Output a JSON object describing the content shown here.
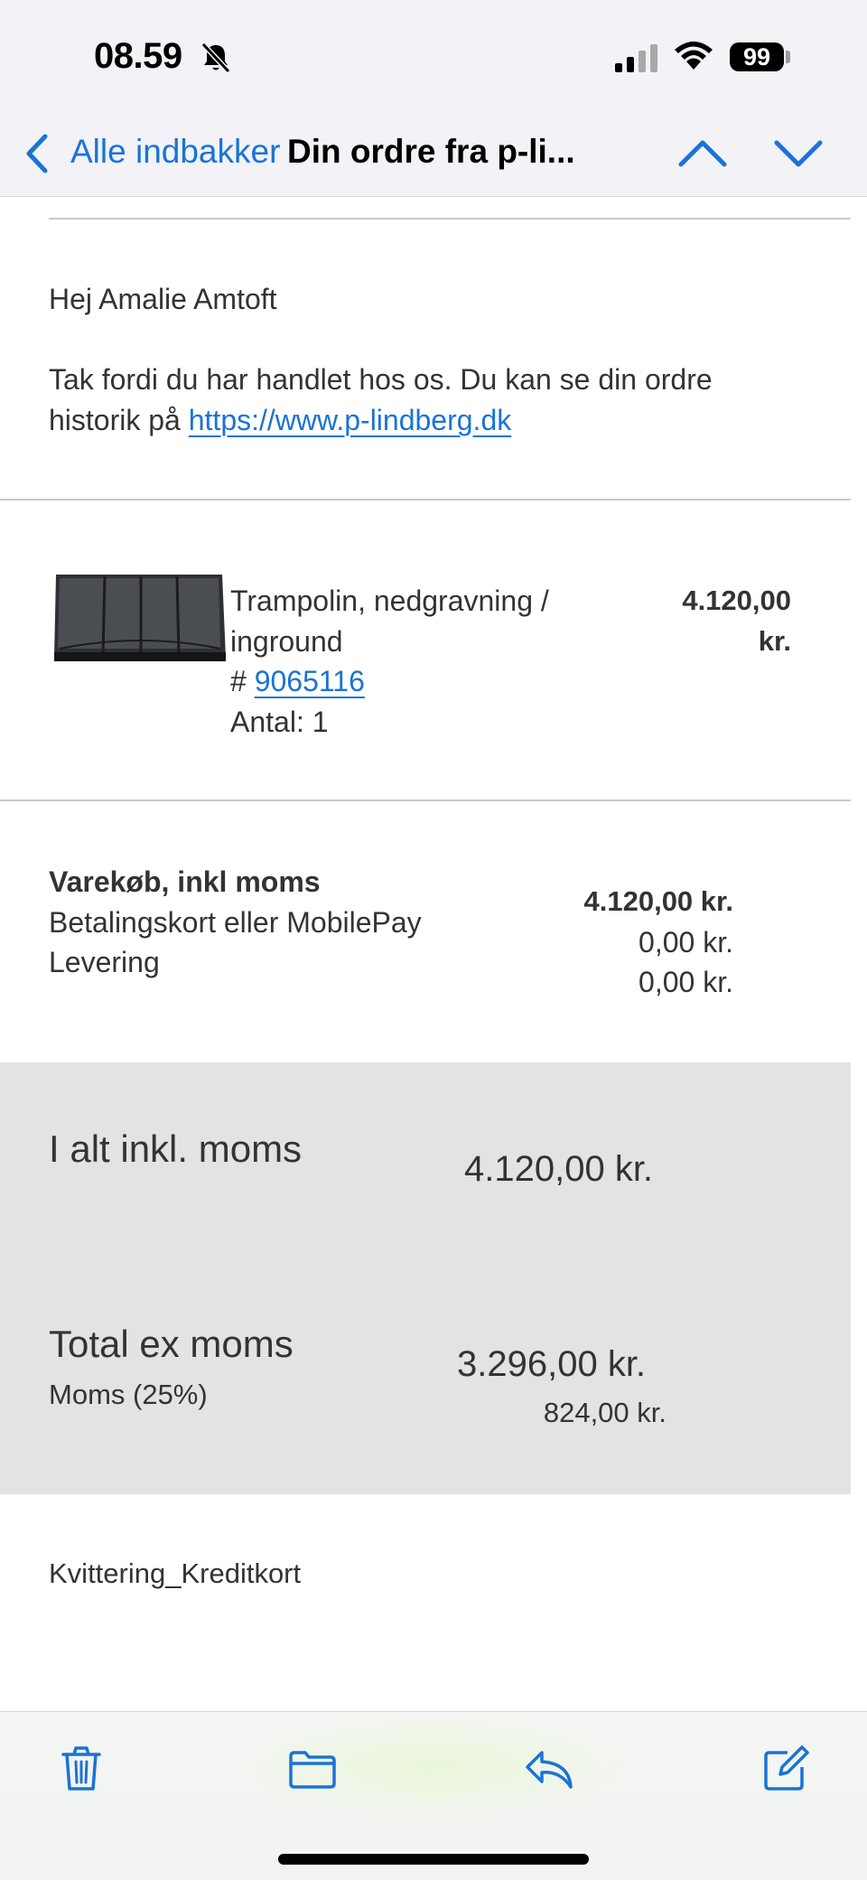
{
  "status_bar": {
    "time": "08.59",
    "battery": "99",
    "icons": [
      "bell-slash-icon",
      "cellular-signal-icon",
      "wifi-icon",
      "battery-icon"
    ]
  },
  "nav": {
    "back_label": "Alle indbakker",
    "title": "Din ordre fra p-li...",
    "accent_color": "#1a73d6"
  },
  "email": {
    "greeting": "Hej Amalie Amtoft",
    "intro_line1": "Tak fordi du har handlet hos os. Du kan se din ordre",
    "intro_line2_prefix": "historik på ",
    "history_link": "https://www.p-lindberg.dk",
    "product": {
      "name_line1": "Trampolin, nedgravning /",
      "name_line2": "inground",
      "sku_prefix": "# ",
      "sku": "9065116",
      "quantity": "Antal: 1",
      "price_line1": "4.120,00",
      "price_line2": "kr."
    },
    "summary": {
      "rows": [
        {
          "label": "Varekøb, inkl moms",
          "value": "4.120,00 kr."
        },
        {
          "label": "Betalingskort eller MobilePay",
          "value": "0,00 kr."
        },
        {
          "label": "Levering",
          "value": "0,00 kr."
        }
      ]
    },
    "totals": {
      "incl_label": "I alt inkl. moms",
      "incl_value": "4.120,00 kr.",
      "ex_label": "Total ex moms",
      "ex_value": "3.296,00 kr.",
      "vat_label": "Moms (25%)",
      "vat_value": "824,00 kr."
    },
    "footer": "Kvittering_Kreditkort"
  },
  "toolbar": {
    "items": [
      "trash-icon",
      "folder-icon",
      "reply-icon",
      "compose-icon"
    ]
  }
}
